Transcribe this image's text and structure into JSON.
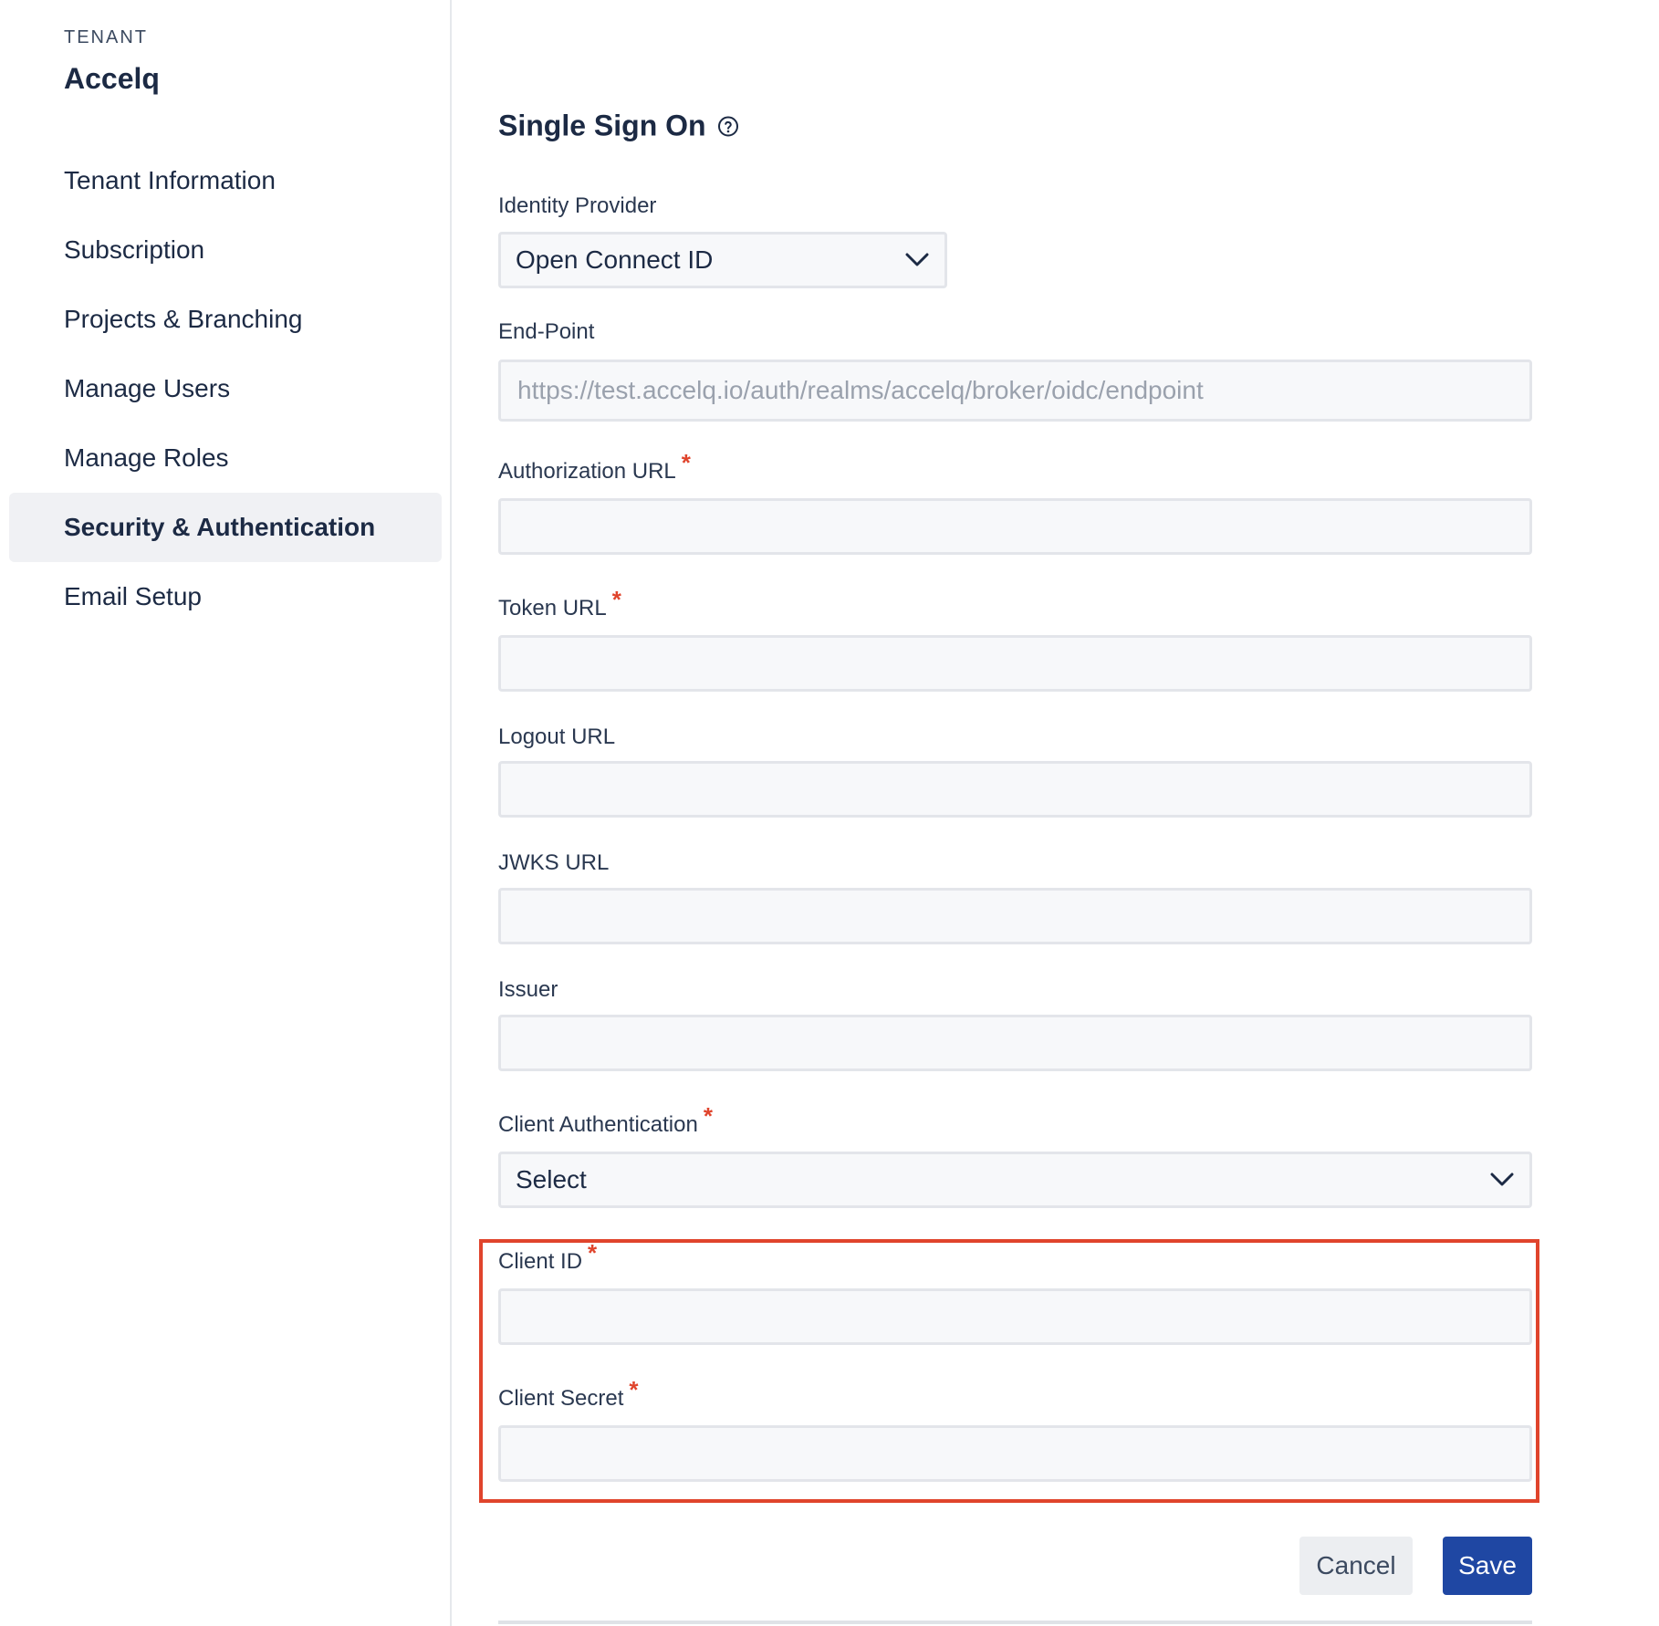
{
  "sidebar": {
    "section_label": "TENANT",
    "tenant_name": "Accelq",
    "items": [
      {
        "label": "Tenant Information"
      },
      {
        "label": "Subscription"
      },
      {
        "label": "Projects & Branching"
      },
      {
        "label": "Manage Users"
      },
      {
        "label": "Manage Roles"
      },
      {
        "label": "Security & Authentication",
        "active": true
      },
      {
        "label": "Email Setup"
      }
    ]
  },
  "main": {
    "title": "Single Sign On",
    "help_icon": "question-circle-icon",
    "identity_provider": {
      "label": "Identity Provider",
      "value": "Open Connect ID",
      "icon": "chevron-down-icon"
    },
    "endpoint": {
      "label": "End-Point",
      "placeholder": "https://test.accelq.io/auth/realms/accelq/broker/oidc/endpoint"
    },
    "authorization_url": {
      "label": "Authorization URL",
      "required": "*",
      "value": ""
    },
    "token_url": {
      "label": "Token URL",
      "required": "*",
      "value": ""
    },
    "logout_url": {
      "label": "Logout URL",
      "value": ""
    },
    "jwks_url": {
      "label": "JWKS URL",
      "value": ""
    },
    "issuer": {
      "label": "Issuer",
      "value": ""
    },
    "client_authentication": {
      "label": "Client Authentication",
      "required": "*",
      "value": "Select",
      "icon": "chevron-down-icon"
    },
    "client_id": {
      "label": "Client ID",
      "required": "*",
      "value": ""
    },
    "client_secret": {
      "label": "Client Secret",
      "required": "*",
      "value": ""
    },
    "cancel_label": "Cancel",
    "save_label": "Save",
    "colors": {
      "accent": "#1f47a3",
      "required": "#e0442c",
      "highlight": "#e0442c"
    }
  }
}
